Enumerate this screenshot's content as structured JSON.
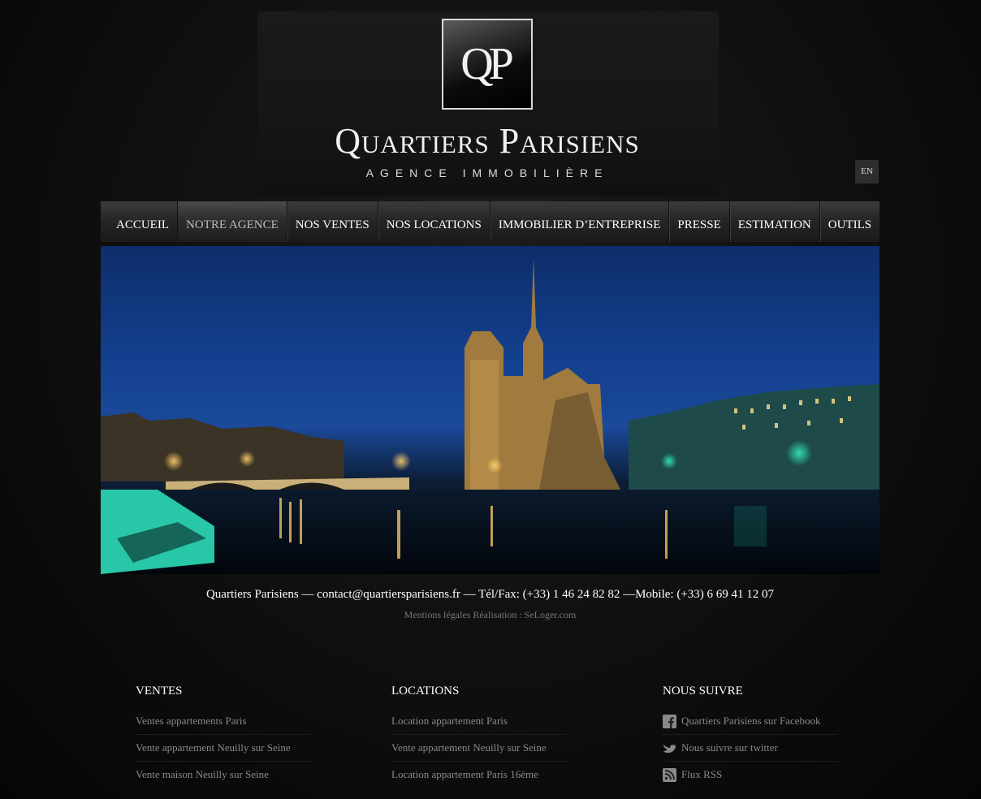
{
  "brand": {
    "monogram": "QP",
    "name": "Quartiers Parisiens",
    "tagline": "AGENCE IMMOBILIÈRE"
  },
  "language_switch": "EN",
  "nav": {
    "items": [
      {
        "label": "ACCUEIL"
      },
      {
        "label": "NOTRE AGENCE",
        "active": true
      },
      {
        "label": "NOS VENTES"
      },
      {
        "label": "NOS LOCATIONS"
      },
      {
        "label": "IMMOBILIER D’ENTREPRISE"
      },
      {
        "label": "PRESSE"
      },
      {
        "label": "ESTIMATION"
      },
      {
        "label": "OUTILS"
      }
    ]
  },
  "footer": {
    "contact": "Quartiers Parisiens — contact@quartiersparisiens.fr — Tél/Fax: (+33) 1 46 24 82 82 —Mobile: (+33) 6 69 41 12 07",
    "legal": "Mentions légales",
    "credit": "Réalisation : SeLoger.com"
  },
  "columns": {
    "ventes": {
      "title": "VENTES",
      "links": [
        "Ventes appartements Paris",
        "Vente appartement Neuilly sur Seine",
        "Vente maison Neuilly sur Seine"
      ]
    },
    "locations": {
      "title": "LOCATIONS",
      "links": [
        "Location appartement Paris",
        "Vente appartement Neuilly sur Seine",
        "Location appartement Paris 16ème"
      ]
    },
    "social": {
      "title": "NOUS SUIVRE",
      "links": [
        {
          "label": "Quartiers Parisiens sur Facebook",
          "icon": "facebook-icon"
        },
        {
          "label": "Nous suivre sur twitter",
          "icon": "twitter-bird-icon"
        },
        {
          "label": "Flux RSS",
          "icon": "rss-icon"
        }
      ]
    }
  }
}
